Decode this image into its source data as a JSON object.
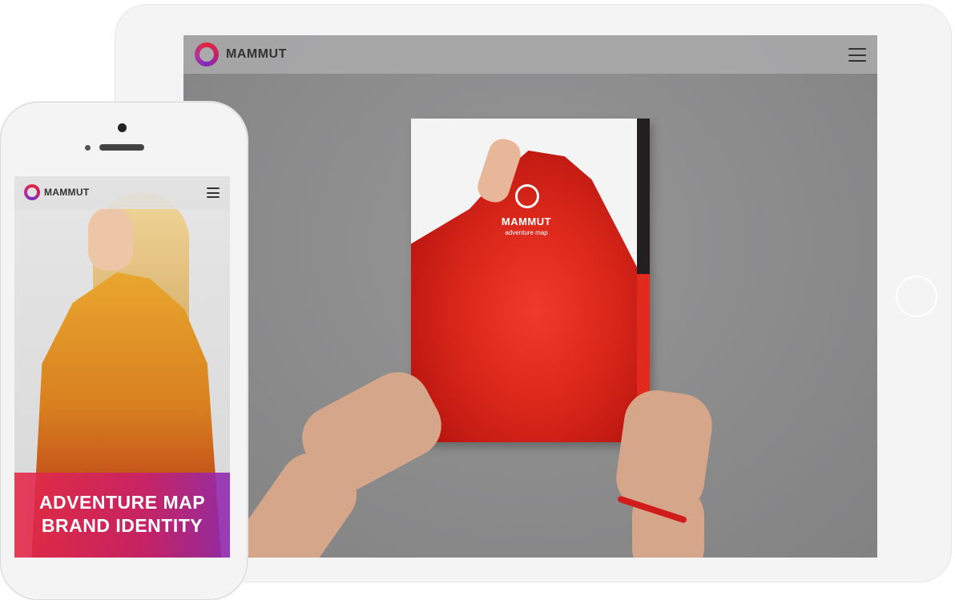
{
  "tablet": {
    "nav": {
      "brand": "MAMMUT",
      "menu_icon": "hamburger-icon"
    },
    "brochure": {
      "title": "MAMMUT",
      "subtitle": "adventure map"
    }
  },
  "phone": {
    "nav": {
      "brand": "MAMMUT",
      "menu_icon": "hamburger-icon"
    },
    "hero": {
      "line1": "ADVENTURE MAP",
      "line2": "BRAND IDENTITY"
    }
  },
  "colors": {
    "accent_red": "#e2263a",
    "accent_purple": "#7b2bbf",
    "brochure_red": "#d32416"
  }
}
